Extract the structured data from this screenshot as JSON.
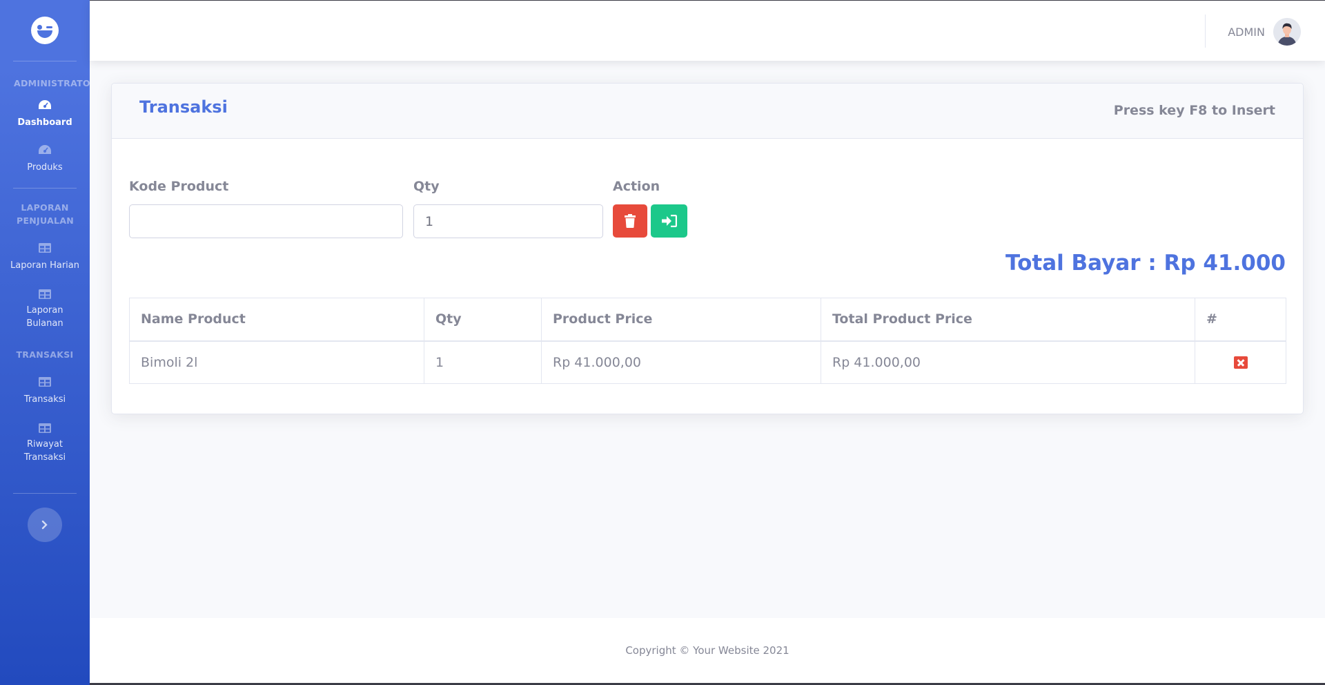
{
  "sidebar": {
    "brand_icon": "laugh-wink-icon",
    "sections": [
      {
        "heading": "ADMINISTRATOR"
      },
      {
        "heading": "LAPORAN PENJUALAN"
      },
      {
        "heading": "TRANSAKSI"
      }
    ],
    "items": [
      {
        "label": "Dashboard",
        "icon": "tachometer-icon",
        "active": true
      },
      {
        "label": "Produks",
        "icon": "tachometer-icon"
      },
      {
        "label": "Laporan Harian",
        "icon": "table-icon"
      },
      {
        "label": "Laporan Bulanan",
        "icon": "table-icon"
      },
      {
        "label": "Transaksi",
        "icon": "table-icon"
      },
      {
        "label": "Riwayat Transaksi",
        "icon": "table-icon"
      }
    ],
    "toggle_icon": "chevron-right-icon"
  },
  "topbar": {
    "username": "ADMIN"
  },
  "card": {
    "title": "Transaksi",
    "hint": "Press key F8 to Insert"
  },
  "form": {
    "kode_label": "Kode Product",
    "kode_value": "",
    "qty_label": "Qty",
    "qty_value": "1",
    "action_label": "Action"
  },
  "total": "Total Bayar : Rp 41.000",
  "table": {
    "headers": [
      "Name Product",
      "Qty",
      "Product Price",
      "Total Product Price",
      "#"
    ],
    "rows": [
      {
        "name": "Bimoli 2l",
        "qty": "1",
        "price": "Rp 41.000,00",
        "total": "Rp 41.000,00"
      }
    ]
  },
  "footer": {
    "copyright": "Copyright © Your Website 2021"
  },
  "colors": {
    "primary": "#4e73df",
    "danger": "#e74a3b",
    "success": "#1cc88a",
    "text": "#858796"
  }
}
